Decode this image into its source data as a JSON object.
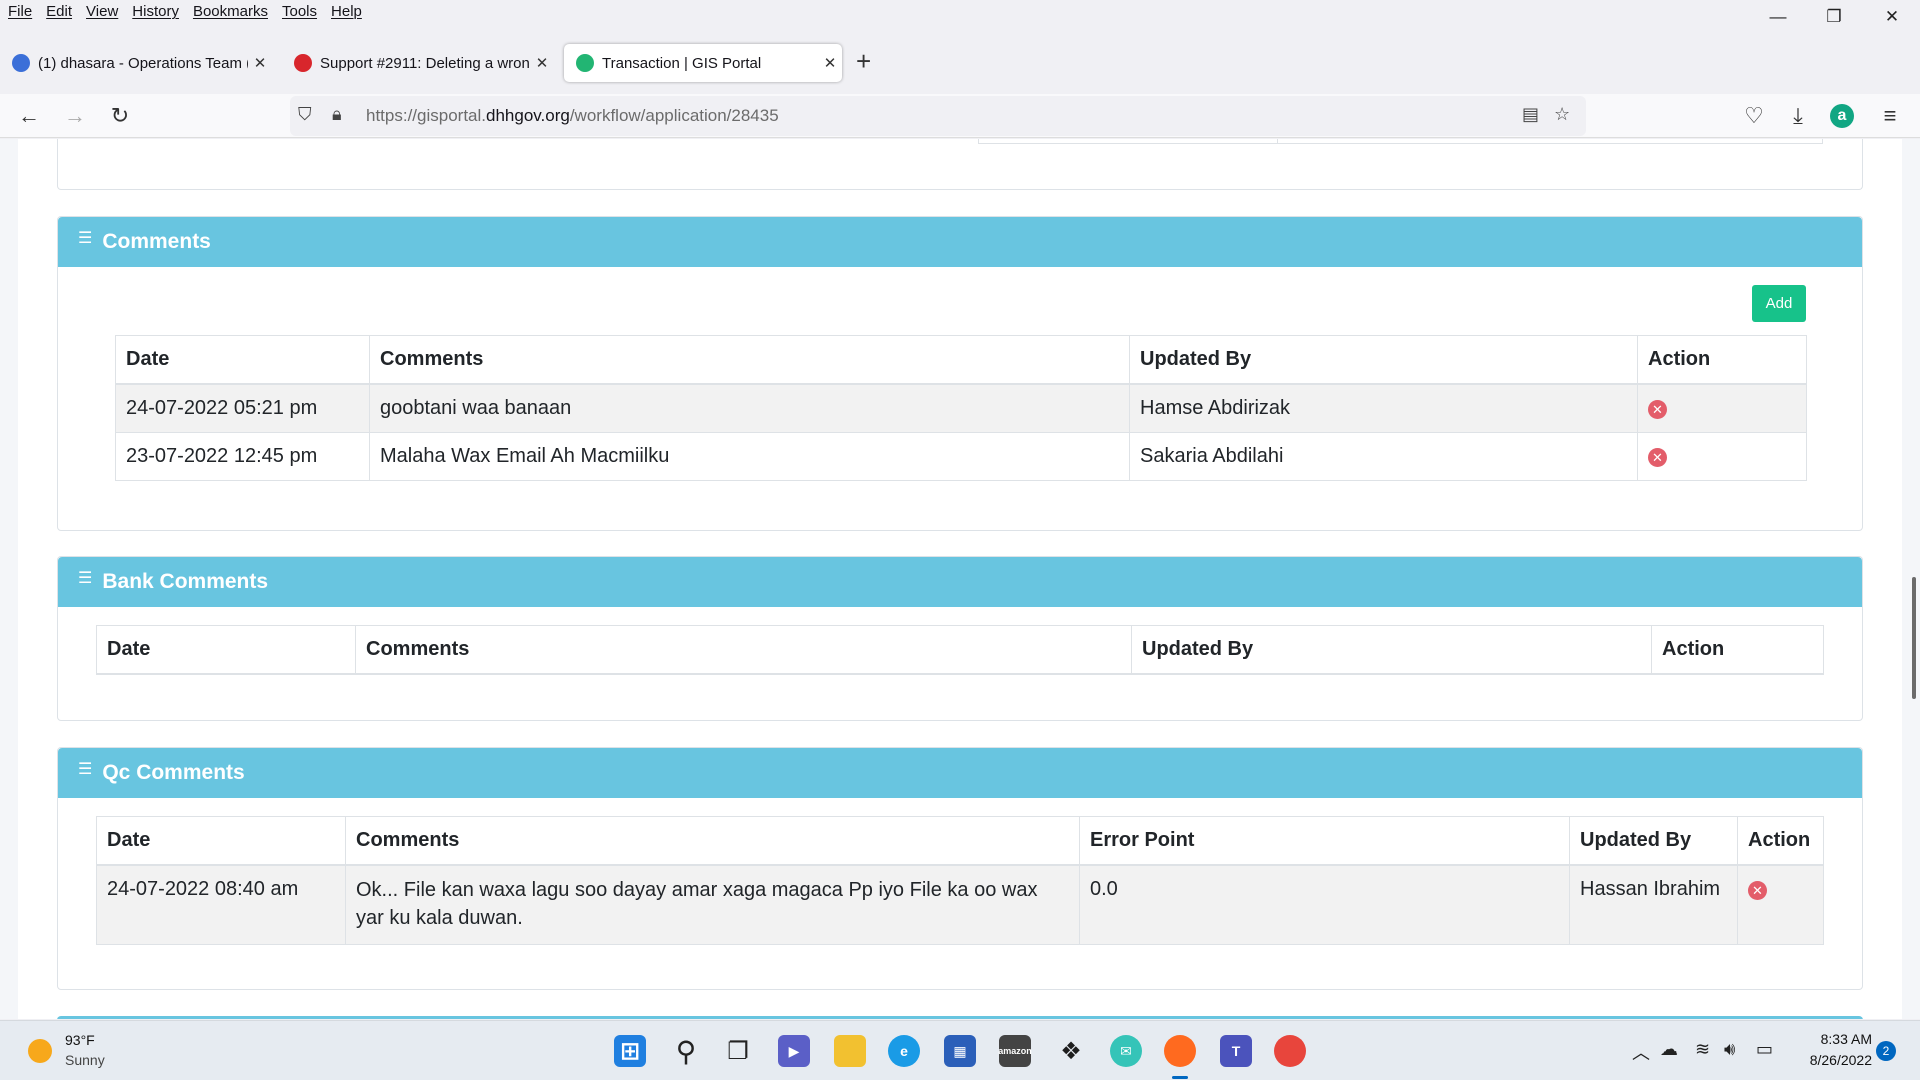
{
  "menu": [
    "File",
    "Edit",
    "View",
    "History",
    "Bookmarks",
    "Tools",
    "Help"
  ],
  "window_controls": {
    "minimize": "—",
    "restore": "❐",
    "close": "✕"
  },
  "tabs": [
    {
      "title": "(1) dhasara - Operations Team (",
      "close": "✕"
    },
    {
      "title": "Support #2911: Deleting a wron",
      "close": "✕"
    },
    {
      "title": "Transaction | GIS Portal",
      "close": "✕"
    }
  ],
  "new_tab": "+",
  "url": {
    "prefix": "https://gisportal.",
    "domain": "dhhgov.org",
    "path": "/workflow/application/28435"
  },
  "comments": {
    "title": "Comments",
    "add_label": "Add",
    "headers": [
      "Date",
      "Comments",
      "Updated By",
      "Action"
    ],
    "rows": [
      {
        "date": "24-07-2022 05:21 pm",
        "comment": "goobtani waa banaan",
        "updated_by": "Hamse Abdirizak"
      },
      {
        "date": "23-07-2022 12:45 pm",
        "comment": "Malaha Wax Email Ah Macmiilku",
        "updated_by": "Sakaria Abdilahi"
      }
    ]
  },
  "bank_comments": {
    "title": "Bank Comments",
    "headers": [
      "Date",
      "Comments",
      "Updated By",
      "Action"
    ]
  },
  "qc_comments": {
    "title": "Qc Comments",
    "headers": [
      "Date",
      "Comments",
      "Error Point",
      "Updated By",
      "Action"
    ],
    "rows": [
      {
        "date": "24-07-2022 08:40 am",
        "comment": "Ok... File kan waxa lagu soo dayay amar xaga magaca Pp iyo File ka oo wax yar ku kala duwan.",
        "error_point": "0.0",
        "updated_by": "Hassan Ibrahim"
      }
    ]
  },
  "taskbar": {
    "weather_temp": "93°F",
    "weather_desc": "Sunny",
    "time": "8:33 AM",
    "date": "8/26/2022",
    "notifications": "2"
  },
  "colors": {
    "section_header": "#68c5e0",
    "add_button": "#17c28a",
    "delete_icon": "#e35d6a"
  }
}
